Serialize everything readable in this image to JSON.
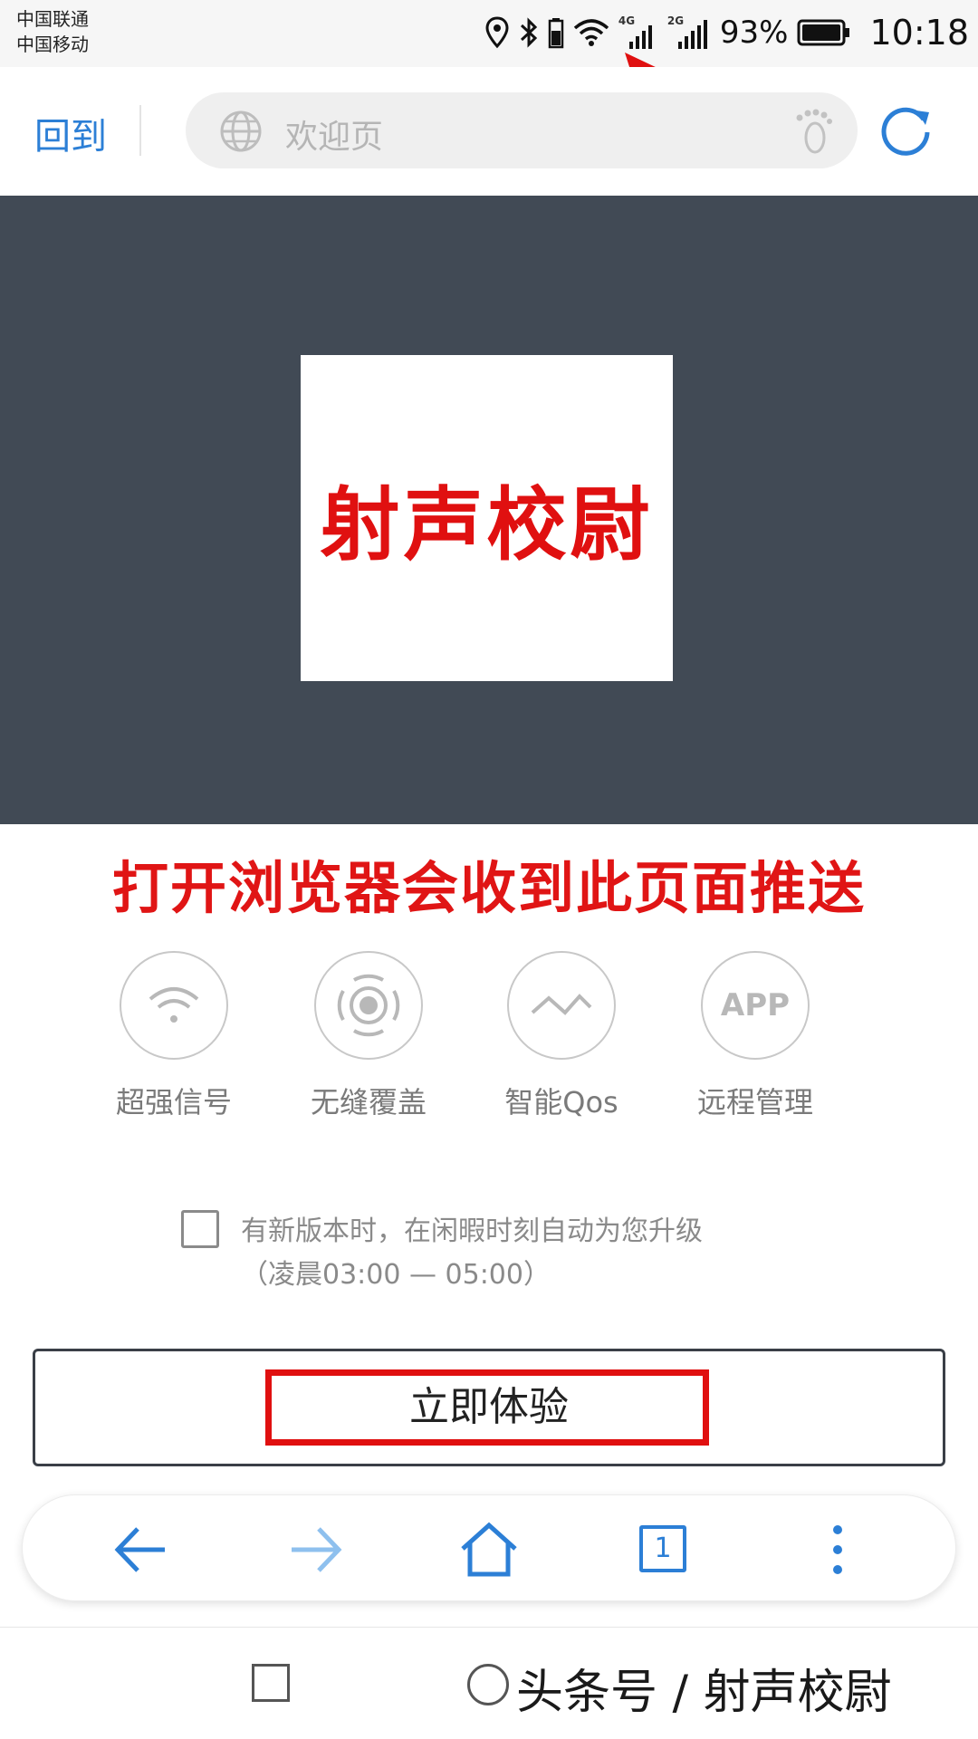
{
  "status_bar": {
    "carrier_1": "中国联通",
    "carrier_2": "中国移动",
    "network_1": "4G",
    "network_2": "2G",
    "battery": "93%",
    "time": "10:18",
    "icons": [
      "location-icon",
      "bluetooth-icon",
      "battery-small-icon",
      "wifi-icon",
      "signal-icon",
      "signal-icon",
      "battery-icon"
    ]
  },
  "address_bar": {
    "back_label": "回到",
    "url_placeholder": "欢迎页",
    "icons": [
      "globe-icon",
      "footprint-icon",
      "refresh-icon"
    ]
  },
  "banner": {
    "logo_text": "射声校尉"
  },
  "push_title": "打开浏览器会收到此页面推送",
  "features": [
    {
      "label": "超强信号",
      "icon": "wifi-signal-icon"
    },
    {
      "label": "无缝覆盖",
      "icon": "coverage-icon"
    },
    {
      "label": "智能Qos",
      "icon": "wave-icon"
    },
    {
      "label": "远程管理",
      "icon": "app-icon",
      "icon_text": "APP"
    }
  ],
  "upgrade": {
    "line1": "有新版本时，在闲暇时刻自动为您升级",
    "line2": "（凌晨03:00 — 05:00）",
    "checked": false
  },
  "cta": {
    "label": "立即体验"
  },
  "browser_nav": {
    "tab_count": "1",
    "icons": [
      "back-arrow-icon",
      "forward-arrow-icon",
      "home-icon",
      "tabs-icon",
      "more-icon"
    ]
  },
  "watermark": "头条号 / 射声校尉",
  "colors": {
    "accent": "#2c7fd6",
    "banner_bg": "#414a55",
    "highlight_red": "#e01010"
  }
}
